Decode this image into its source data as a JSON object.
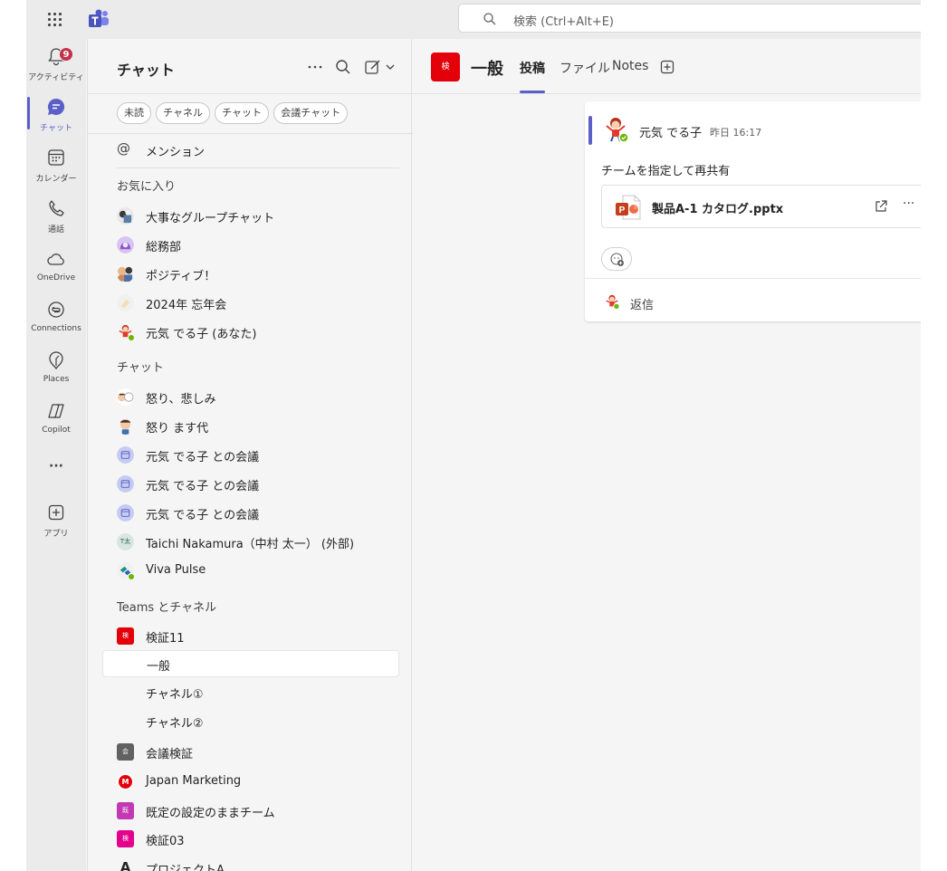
{
  "titlebar": {
    "search_placeholder": "検索 (Ctrl+Alt+E)"
  },
  "rail": {
    "items": [
      {
        "label": "アクティビティ",
        "icon": "bell-icon",
        "badge": "9"
      },
      {
        "label": "チャット",
        "icon": "chat-icon"
      },
      {
        "label": "カレンダー",
        "icon": "calendar-icon"
      },
      {
        "label": "通話",
        "icon": "phone-icon"
      },
      {
        "label": "OneDrive",
        "icon": "cloud-icon"
      },
      {
        "label": "Connections",
        "icon": "connections-icon"
      },
      {
        "label": "Places",
        "icon": "places-icon"
      },
      {
        "label": "Copilot",
        "icon": "copilot-icon"
      },
      {
        "label": "アプリ",
        "icon": "add-app-icon"
      }
    ],
    "more_label": "···"
  },
  "chatlist": {
    "title": "チャット",
    "filters": [
      "未読",
      "チャネル",
      "チャット",
      "会議チャット"
    ],
    "mentions_label": "メンション",
    "favorites_header": "お気に入り",
    "favorites": [
      "大事なグループチャット",
      "総務部",
      "ポジティブ！",
      "2024年 忘年会",
      "元気 でる子 (あなた)"
    ],
    "chats_header": "チャット",
    "chats": [
      "怒り、悲しみ",
      "怒り ます代",
      "元気 でる子 との会議",
      "元気 でる子 との会議",
      "元気 でる子 との会議",
      "Taichi Nakamura（中村 太一） (外部)",
      "Viva Pulse"
    ],
    "teams_header": "Teams とチャネル",
    "teams": [
      {
        "name": "検証11",
        "tile": "検",
        "color": "#e3000b"
      },
      {
        "name": "一般"
      },
      {
        "name": "チャネル①"
      },
      {
        "name": "チャネル②"
      },
      {
        "name": "会議検証",
        "tile": "会",
        "color": "#616161"
      },
      {
        "name": "Japan Marketing",
        "tile": "M",
        "color": "#e3000b"
      },
      {
        "name": "既定の設定のままチーム",
        "tile": "既",
        "color": "#c239b3"
      },
      {
        "name": "検証03",
        "tile": "検",
        "color": "#e3008c"
      },
      {
        "name": "プロジェクトA",
        "tile": "A"
      }
    ],
    "taichi_initials": "T太"
  },
  "channel": {
    "tile_text": "検",
    "name": "一般",
    "tabs": [
      "投稿",
      "ファイル",
      "Notes"
    ]
  },
  "post": {
    "author": "元気 でる子",
    "time": "昨日 16:17",
    "body": "チームを指定して再共有",
    "file_name": "製品A-1 カタログ.pptx",
    "more": "···",
    "reply_label": "返信"
  },
  "colors": {
    "accent": "#5b5fc7",
    "badge": "#c4314b",
    "presence_available": "#6bb700"
  }
}
